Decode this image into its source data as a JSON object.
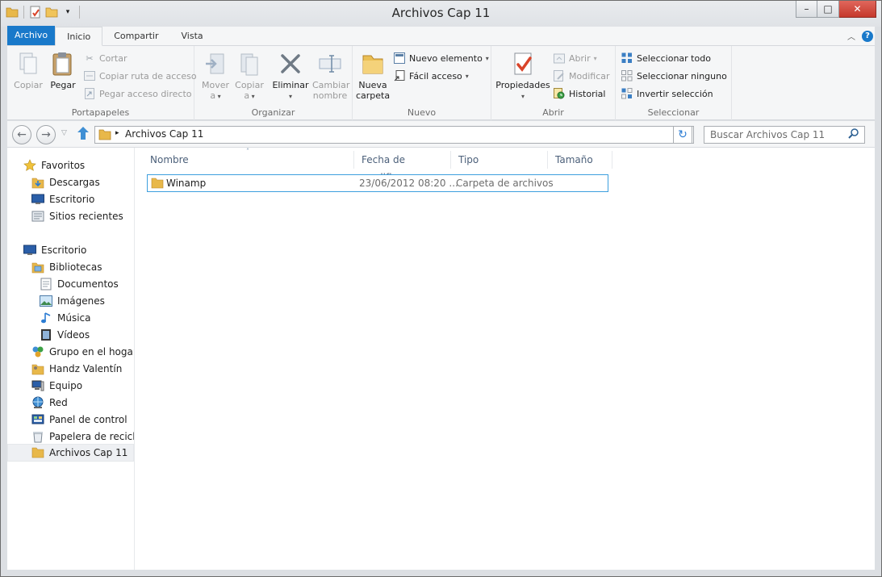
{
  "window": {
    "title": "Archivos Cap 11",
    "controls": {
      "minimize": "–",
      "maximize": "□",
      "close": "✕"
    }
  },
  "ribbon_tabs": [
    "Archivo",
    "Inicio",
    "Compartir",
    "Vista"
  ],
  "ribbon": {
    "portapapeles": {
      "label": "Portapapeles",
      "copiar": "Copiar",
      "pegar": "Pegar",
      "cortar": "Cortar",
      "copiar_ruta": "Copiar ruta de acceso",
      "pegar_acceso": "Pegar acceso directo"
    },
    "organizar": {
      "label": "Organizar",
      "mover_a": [
        "Mover",
        "a"
      ],
      "copiar_a": [
        "Copiar",
        "a"
      ],
      "eliminar": "Eliminar",
      "cambiar_nombre": [
        "Cambiar",
        "nombre"
      ]
    },
    "nuevo": {
      "label": "Nuevo",
      "nueva_carpeta": [
        "Nueva",
        "carpeta"
      ],
      "nuevo_elemento": "Nuevo elemento",
      "facil_acceso": "Fácil acceso"
    },
    "abrir": {
      "label": "Abrir",
      "propiedades": "Propiedades",
      "abrir": "Abrir",
      "modificar": "Modificar",
      "historial": "Historial"
    },
    "seleccionar": {
      "label": "Seleccionar",
      "todo": "Seleccionar todo",
      "ninguno": "Seleccionar ninguno",
      "invertir": "Invertir selección"
    }
  },
  "address": {
    "path": "Archivos Cap 11",
    "search_placeholder": "Buscar Archivos Cap 11"
  },
  "nav": {
    "favoritos": "Favoritos",
    "descargas": "Descargas",
    "escritorio_fav": "Escritorio",
    "sitios": "Sitios recientes",
    "escritorio": "Escritorio",
    "bibliotecas": "Bibliotecas",
    "documentos": "Documentos",
    "imagenes": "Imágenes",
    "musica": "Música",
    "videos": "Vídeos",
    "grupo": "Grupo en el hogar",
    "usuario": "Handz Valentín",
    "equipo": "Equipo",
    "red": "Red",
    "panel": "Panel de control",
    "papelera": "Papelera de reciclaje",
    "archivos": "Archivos Cap 11"
  },
  "columns": {
    "nombre": "Nombre",
    "fecha": "Fecha de modifica...",
    "tipo": "Tipo",
    "tamano": "Tamaño"
  },
  "files": [
    {
      "name": "Winamp",
      "date": "23/06/2012 08:20 ...",
      "type": "Carpeta de archivos",
      "size": ""
    }
  ],
  "colors": {
    "accent": "#1979ca",
    "folder": "#e8b84a",
    "selection_border": "#3d9fde"
  }
}
